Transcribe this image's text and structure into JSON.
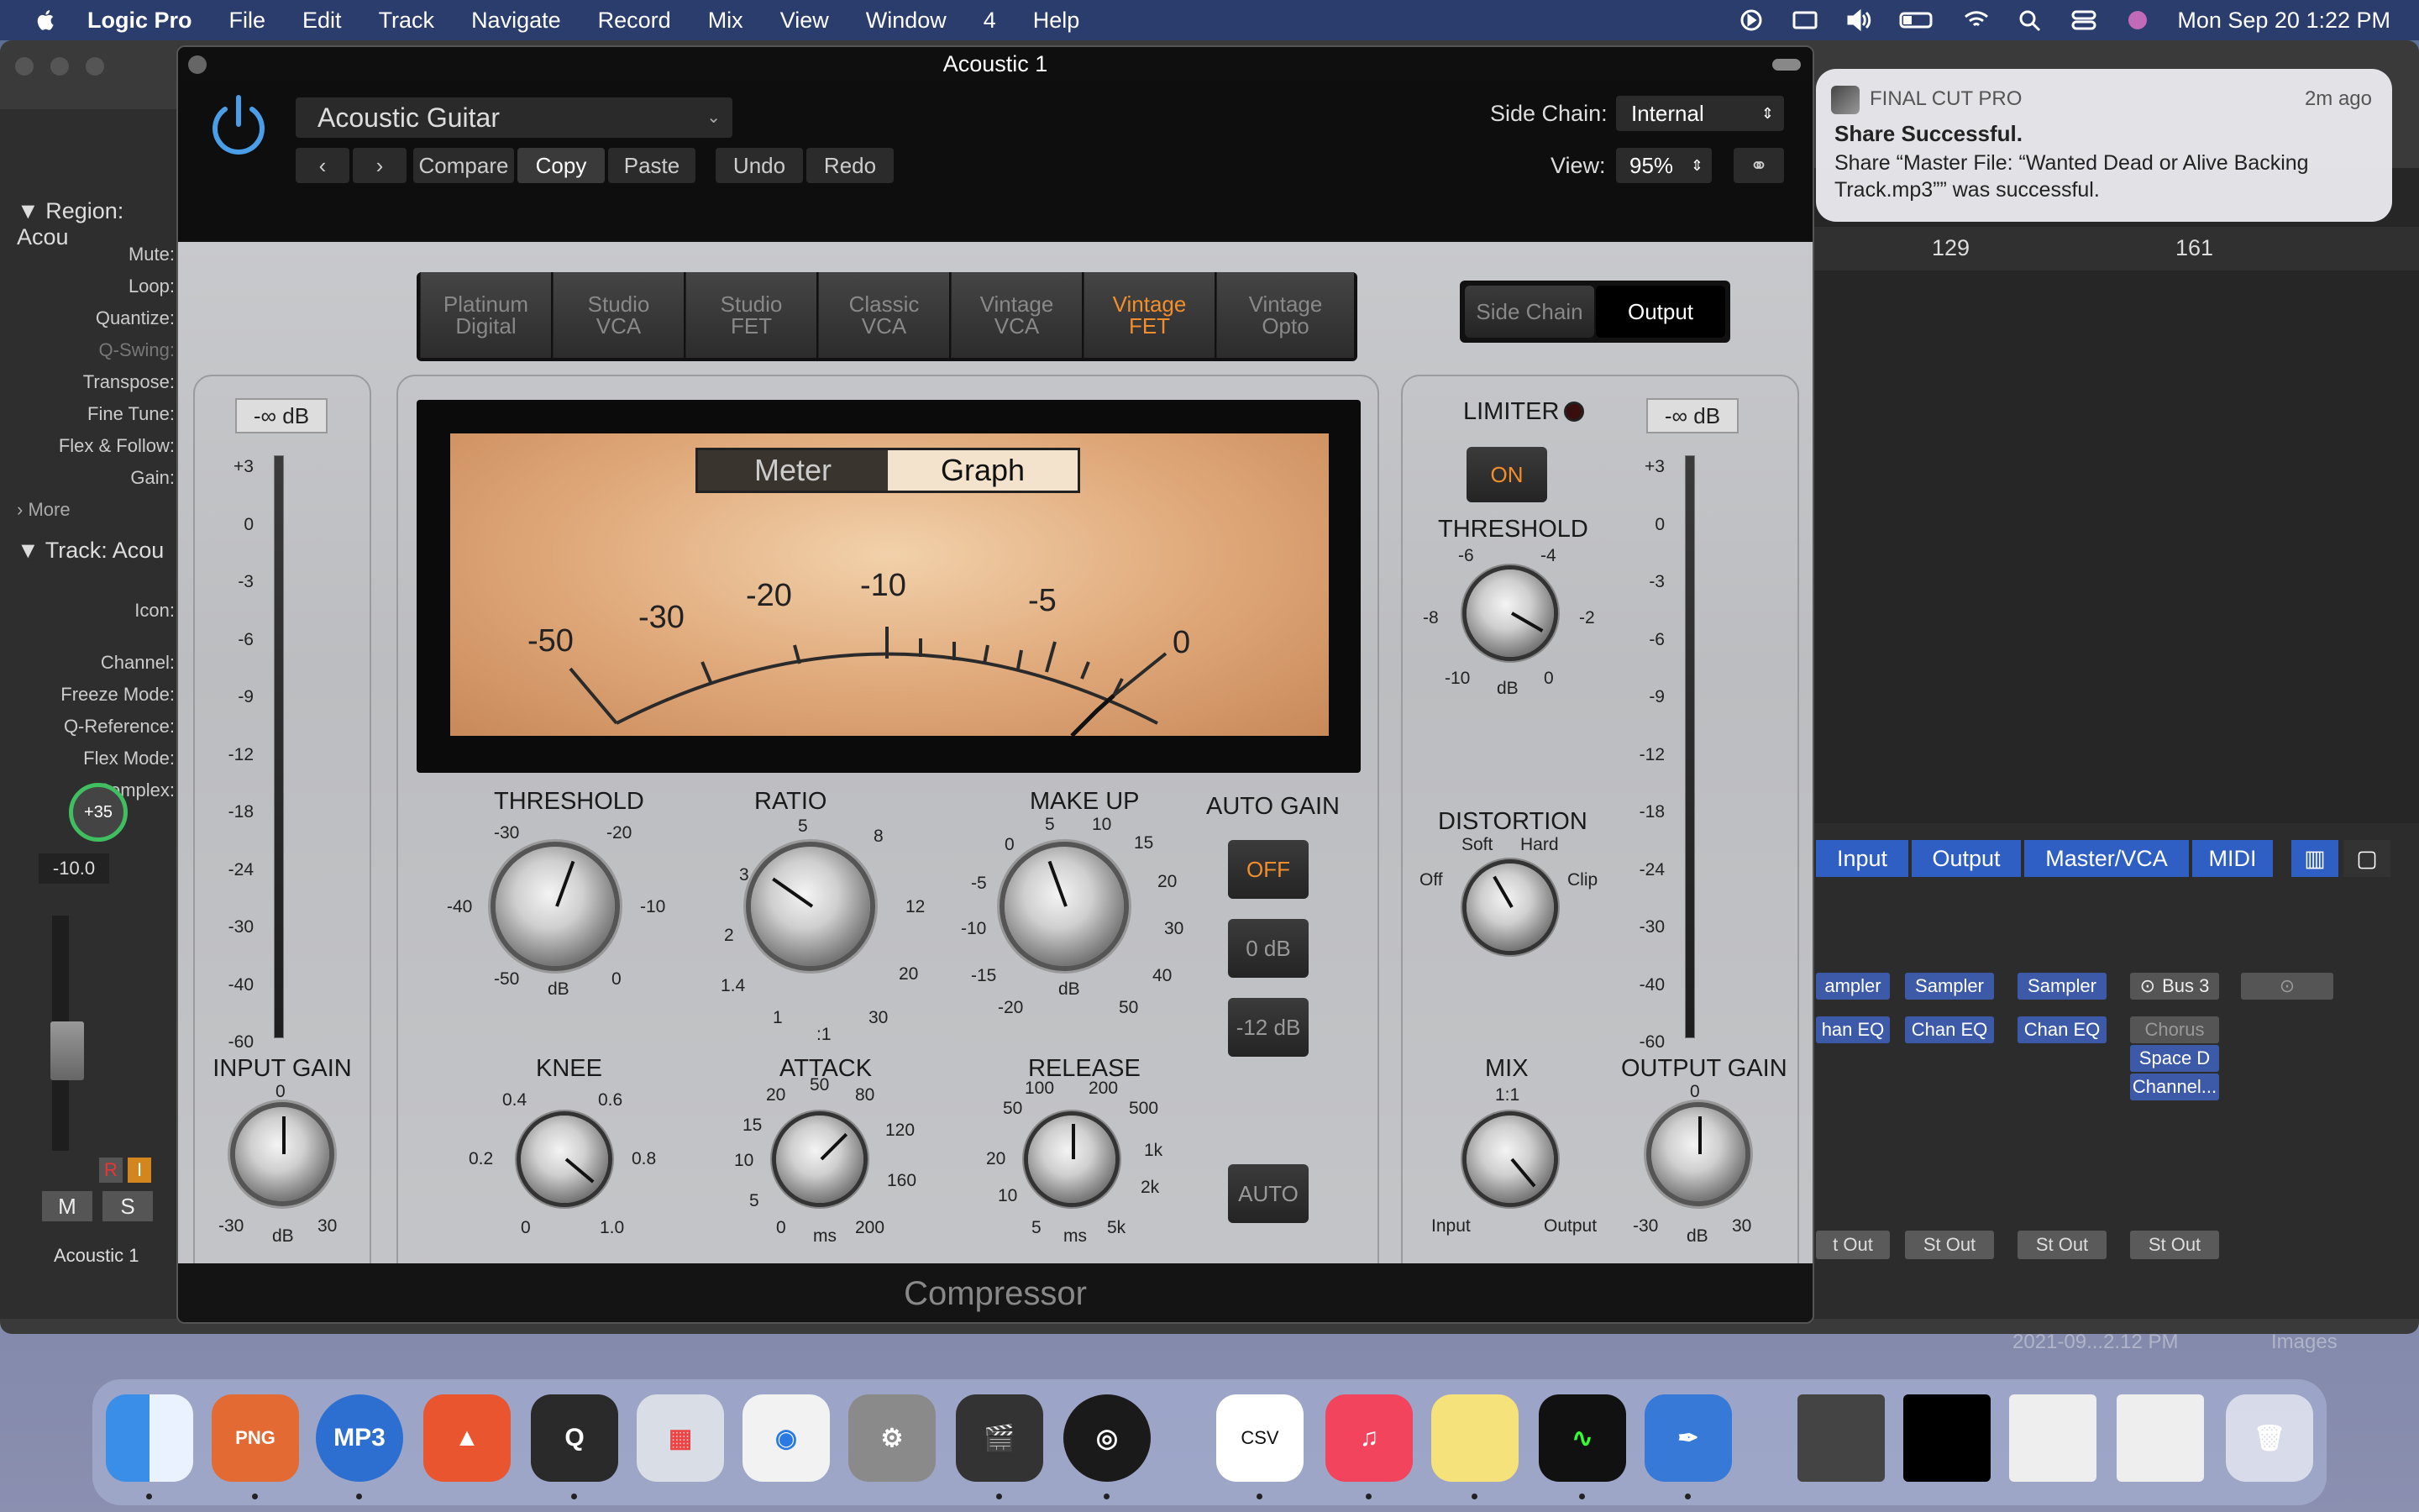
{
  "menubar": {
    "app": "Logic Pro",
    "items": [
      "File",
      "Edit",
      "Track",
      "Navigate",
      "Record",
      "Mix",
      "View",
      "Window",
      "4",
      "Help"
    ],
    "clock": "Mon Sep 20  1:22 PM"
  },
  "inspector": {
    "region_header": "Region: Acou",
    "region_fields": [
      "Mute:",
      "Loop:",
      "Quantize:",
      "Q-Swing:",
      "Transpose:",
      "Fine Tune:",
      "Flex & Follow:",
      "Gain:"
    ],
    "more": "More",
    "track_header": "Track:  Acou",
    "track_fields": [
      "Icon:",
      "Channel:",
      "Freeze Mode:",
      "Q-Reference:",
      "Flex Mode:",
      "Complex:"
    ],
    "pan": "+35",
    "volume": "-10.0",
    "rec": "R",
    "input": "I",
    "mute": "M",
    "solo": "S",
    "track_name": "Acoustic 1"
  },
  "tracks": {
    "ruler": [
      "129",
      "161"
    ]
  },
  "mixer": {
    "tabs": [
      "Input",
      "Output",
      "Master/VCA",
      "MIDI"
    ],
    "col1": [
      "ampler",
      "han EQ",
      "t Out"
    ],
    "col2": [
      "Sampler",
      "Chan EQ",
      "St Out"
    ],
    "col3": [
      "Sampler",
      "Chan EQ",
      "St Out"
    ],
    "col4": [
      "Bus 3",
      "Chorus",
      "Space D",
      "Channel...",
      "St Out"
    ],
    "bottom_labels": [
      "2021-09...2.12 PM",
      "Images"
    ]
  },
  "notification": {
    "app": "FINAL CUT PRO",
    "time": "2m ago",
    "title": "Share Successful.",
    "body": "Share “Master File: “Wanted Dead or Alive Backing Track.mp3”” was successful."
  },
  "plugin": {
    "window_title": "Acoustic 1",
    "preset": "Acoustic Guitar",
    "compare": "Compare",
    "copy": "Copy",
    "paste": "Paste",
    "undo": "Undo",
    "redo": "Redo",
    "sidechain_label": "Side Chain:",
    "sidechain_value": "Internal",
    "view_label": "View:",
    "view_value": "95%",
    "models": [
      "Platinum\nDigital",
      "Studio\nVCA",
      "Studio\nFET",
      "Classic\nVCA",
      "Vintage\nVCA",
      "Vintage\nFET",
      "Vintage\nOpto"
    ],
    "active_model": "Vintage FET",
    "sc_tab": "Side Chain",
    "out_tab": "Output",
    "input_db": "-∞ dB",
    "output_db": "-∞ dB",
    "meter_scale": [
      "+3",
      "0",
      "-3",
      "-6",
      "-9",
      "-12",
      "-18",
      "-24",
      "-30",
      "-40",
      "-60"
    ],
    "meter_mode": {
      "meter": "Meter",
      "graph": "Graph"
    },
    "vu_labels": [
      "-50",
      "-30",
      "-20",
      "-10",
      "-5",
      "0"
    ],
    "threshold": {
      "label": "THRESHOLD",
      "ticks": [
        "-30",
        "-20",
        "-40",
        "-10",
        "-50",
        "0",
        "dB"
      ]
    },
    "ratio": {
      "label": "RATIO",
      "ticks": [
        "5",
        "8",
        "3",
        "12",
        "2",
        "20",
        "1.4",
        "1",
        ":1",
        "30"
      ]
    },
    "makeup": {
      "label": "MAKE UP",
      "ticks": [
        "0",
        "5",
        "10",
        "15",
        "-5",
        "20",
        "-10",
        "30",
        "-15",
        "40",
        "-20",
        "dB",
        "50"
      ]
    },
    "auto_gain": {
      "label": "AUTO GAIN",
      "off": "OFF",
      "zero": "0 dB",
      "minus12": "-12 dB",
      "auto": "AUTO"
    },
    "input_gain": {
      "label": "INPUT GAIN",
      "ticks": [
        "0",
        "-30",
        "dB",
        "30"
      ]
    },
    "knee": {
      "label": "KNEE",
      "ticks": [
        "0.4",
        "0.6",
        "0.2",
        "0.8",
        "0",
        "1.0"
      ]
    },
    "attack": {
      "label": "ATTACK",
      "ticks": [
        "20",
        "50",
        "80",
        "15",
        "120",
        "10",
        "160",
        "5",
        "0",
        "ms",
        "200"
      ]
    },
    "release": {
      "label": "RELEASE",
      "ticks": [
        "100",
        "200",
        "50",
        "500",
        "20",
        "1k",
        "10",
        "2k",
        "5",
        "ms",
        "5k"
      ]
    },
    "limiter": {
      "label": "LIMITER",
      "on": "ON",
      "threshold": "THRESHOLD",
      "ticks": [
        "-6",
        "-4",
        "-8",
        "-2",
        "-10",
        "dB",
        "0"
      ]
    },
    "distortion": {
      "label": "DISTORTION",
      "ticks": [
        "Soft",
        "Hard",
        "Off",
        "Clip"
      ]
    },
    "mix": {
      "label": "MIX",
      "ticks": [
        "1:1",
        "Input",
        "Output"
      ]
    },
    "output_gain": {
      "label": "OUTPUT GAIN",
      "ticks": [
        "0",
        "-30",
        "dB",
        "30"
      ]
    },
    "footer": "Compressor"
  },
  "dock": {
    "labels": [
      "PNG",
      "MP3",
      "CSV"
    ]
  },
  "colors": {
    "accent": "#f28e2b",
    "menubar": "#2b3d6c",
    "mixer_tab": "#2f5fc2"
  }
}
